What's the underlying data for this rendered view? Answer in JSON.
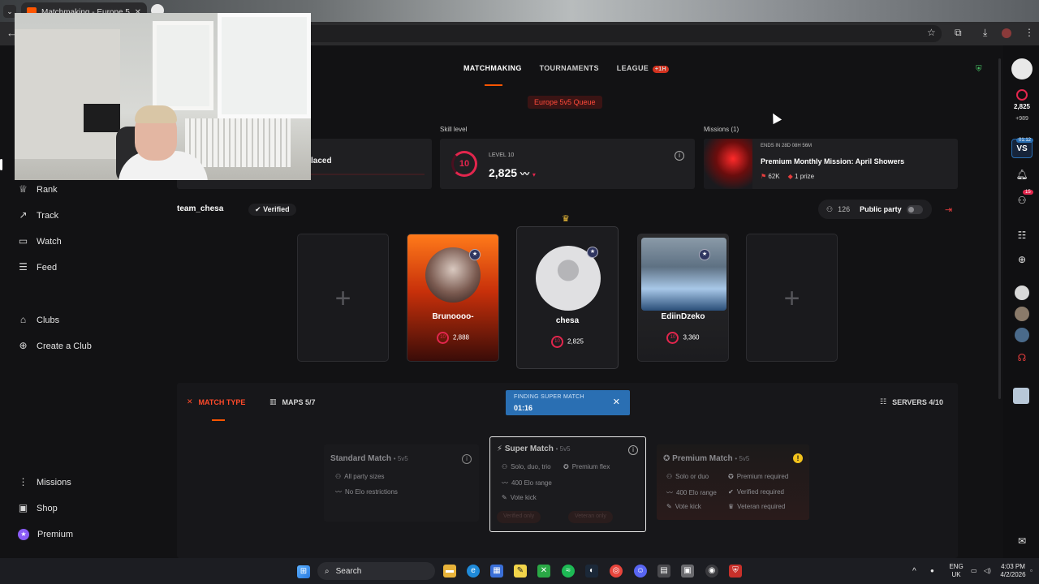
{
  "browser": {
    "tab_title": "Matchmaking - Europe 5v5 Q...",
    "tab_close": "✕"
  },
  "nav": {
    "items": [
      {
        "label": "Rank",
        "icon": "rank-icon"
      },
      {
        "label": "Track",
        "icon": "track-icon"
      },
      {
        "label": "Watch",
        "icon": "watch-icon"
      },
      {
        "label": "Feed",
        "icon": "feed-icon"
      },
      {
        "label": "Clubs",
        "icon": "clubs-icon"
      },
      {
        "label": "Create a Club",
        "icon": "add-circle-icon"
      },
      {
        "label": "Missions",
        "icon": "missions-icon"
      },
      {
        "label": "Shop",
        "icon": "shop-icon"
      },
      {
        "label": "Premium",
        "icon": "premium-icon"
      }
    ]
  },
  "topnav": {
    "matchmaking": "MATCHMAKING",
    "tournaments": "TOURNAMENTS",
    "league": "LEAGUE",
    "league_badge": "+1H"
  },
  "queue": "Europe 5v5 Queue",
  "placed_card": {
    "text": "laced"
  },
  "skill": {
    "heading": "Skill level",
    "level_label": "LEVEL 10",
    "level": "10",
    "elo": "2,825"
  },
  "missions": {
    "heading": "Missions (1)",
    "ends": "ENDS IN 28D 08H 56M",
    "title": "Premium Monthly Mission: April Showers",
    "reward_points": "62K",
    "reward_prize": "1 prize"
  },
  "party": {
    "team_name": "team_chesa",
    "verified": "Verified",
    "count": "126",
    "public_label": "Public party",
    "players": [
      {
        "name": "Brunoooo-",
        "elo": "2,888",
        "level": "10"
      },
      {
        "name": "chesa",
        "elo": "2,825",
        "level": "10"
      },
      {
        "name": "EdiinDzeko",
        "elo": "3,360",
        "level": "10"
      }
    ],
    "empty_slot": "+"
  },
  "lower": {
    "match_type": "MATCH TYPE",
    "maps": "MAPS 5/7",
    "servers": "SERVERS 4/10",
    "finding_label": "FINDING SUPER MATCH",
    "finding_timer": "01:16"
  },
  "match_cards": [
    {
      "title": "Standard Match",
      "sub": "• 5v5",
      "features": [
        "All party sizes",
        "No Elo restrictions"
      ]
    },
    {
      "title": "Super Match",
      "sub": "• 5v5",
      "features": [
        "Solo, duo, trio",
        "Premium flex",
        "400 Elo range",
        "Vote kick"
      ],
      "chips": [
        "Verified only",
        "Veteran only"
      ]
    },
    {
      "title": "Premium Match",
      "sub": "• 5v5",
      "features": [
        "Solo or duo",
        "Premium required",
        "400 Elo range",
        "Verified required",
        "Vote kick",
        "Veteran required"
      ]
    }
  ],
  "rightbar": {
    "elo": "2,825",
    "elo_delta": "+989",
    "vs_badge": "01:12",
    "vs_label": "VS",
    "friends_badge": "15"
  },
  "taskbar": {
    "search": "Search",
    "lang1": "ENG",
    "lang2": "UK",
    "time": "4:03 PM",
    "date": "4/2/2026"
  },
  "colors": {
    "accent": "#ff5500",
    "skill_red": "#e2264d",
    "finding_blue": "#2a6fb3",
    "verified_green": "#4bd06a"
  }
}
